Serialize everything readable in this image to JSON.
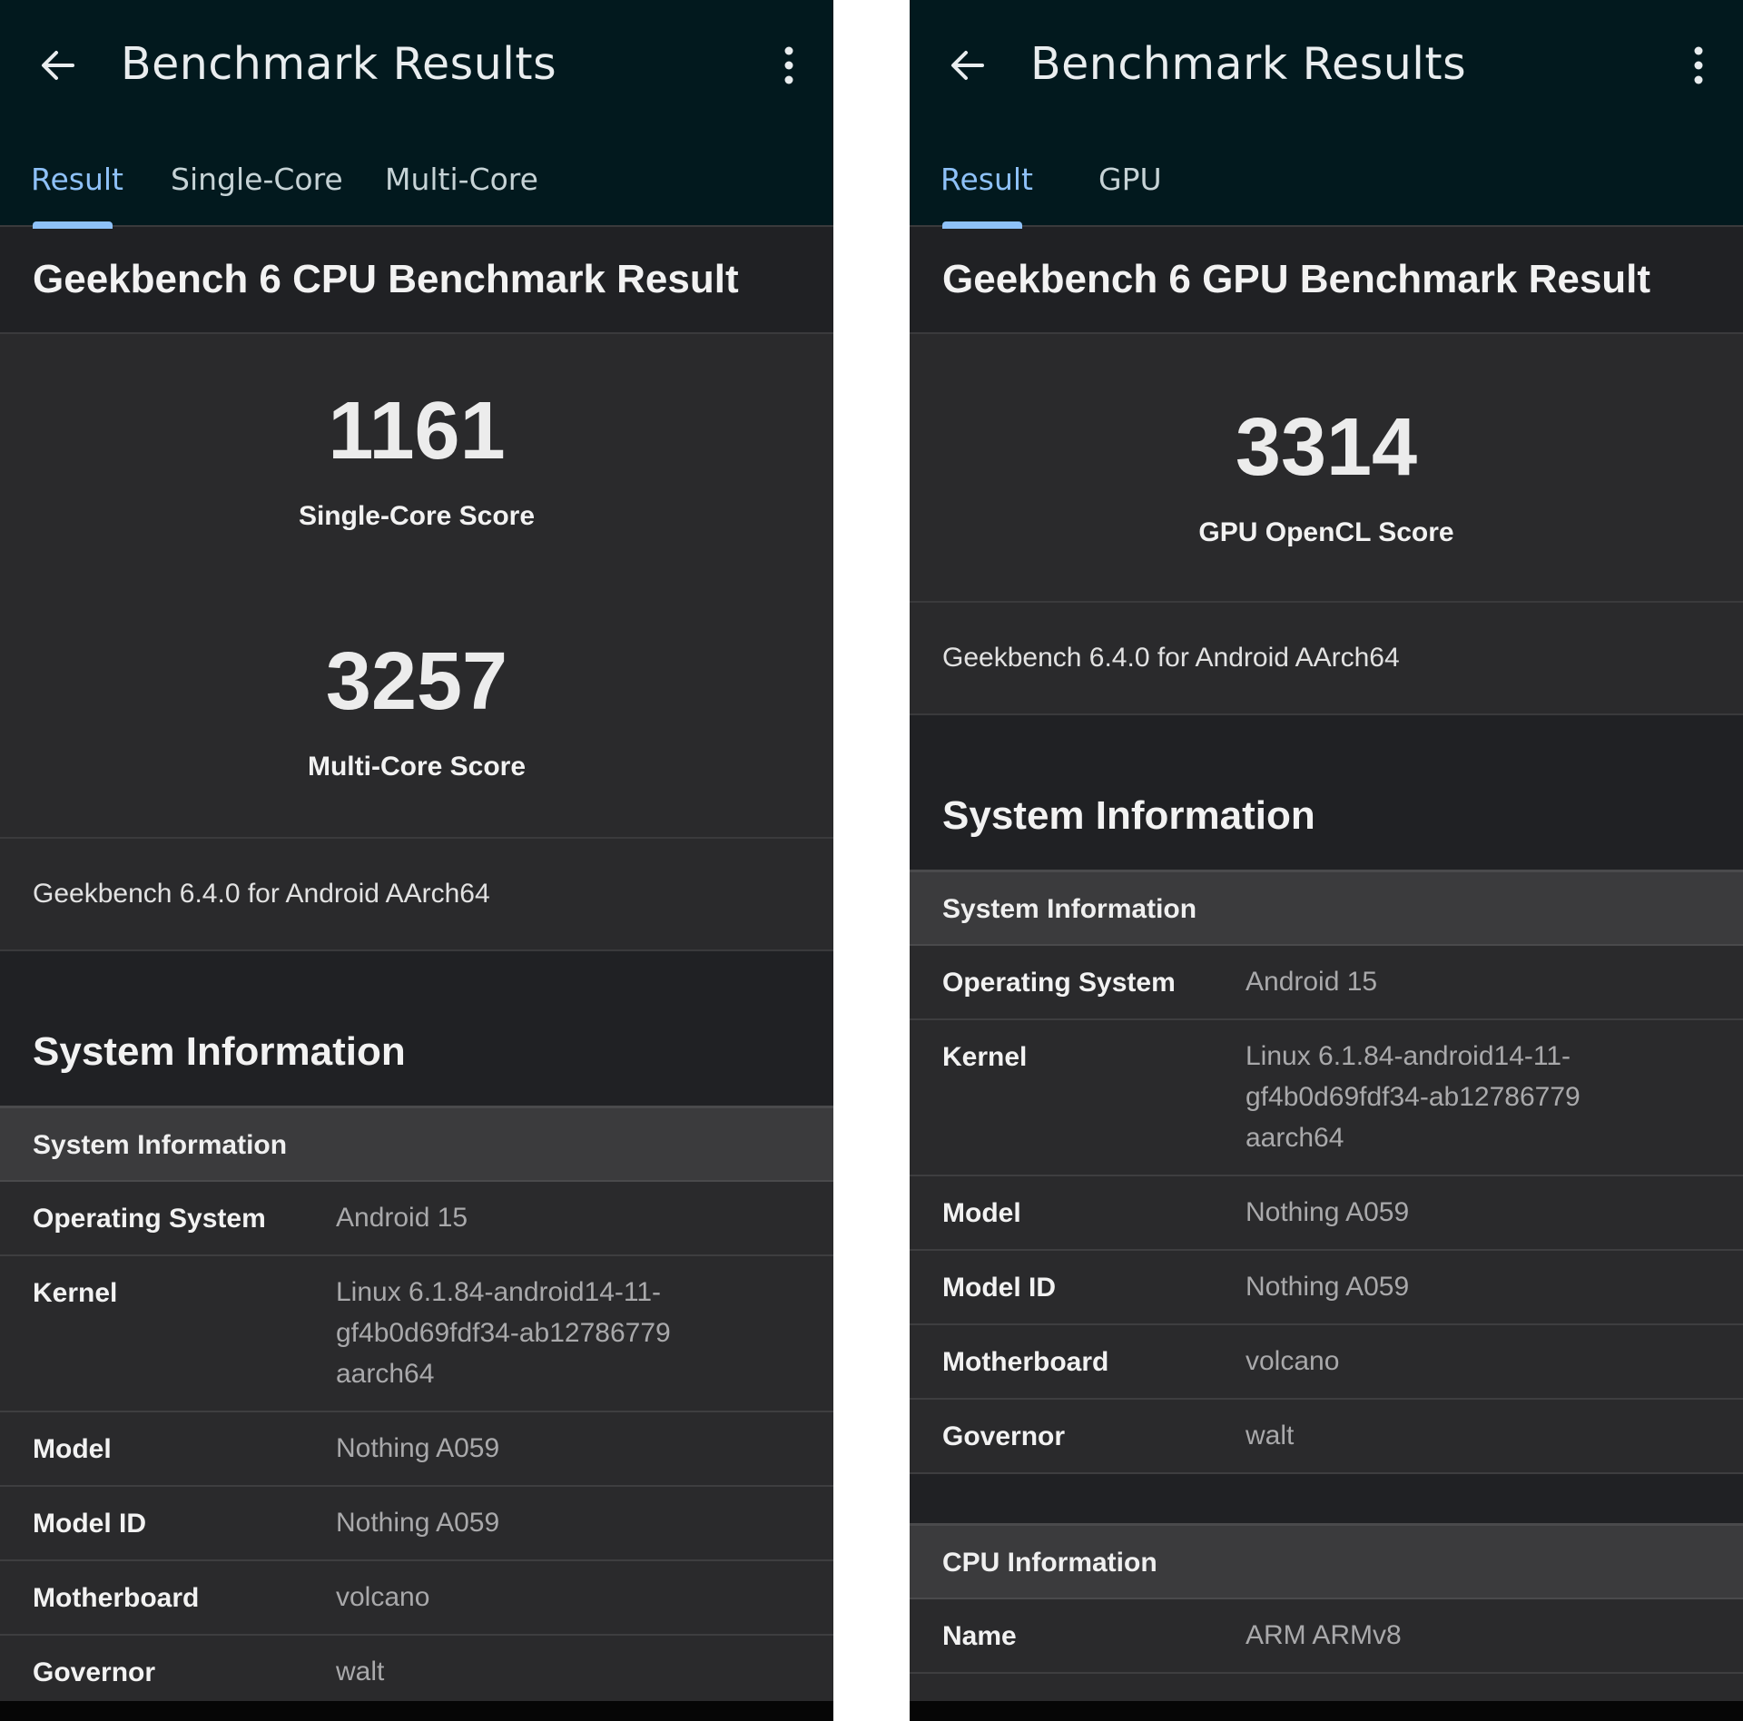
{
  "left": {
    "title": "Benchmark Results",
    "tabs": [
      "Result",
      "Single-Core",
      "Multi-Core"
    ],
    "result_heading": "Geekbench 6 CPU Benchmark Result",
    "scores": [
      {
        "value": "1161",
        "label": "Single-Core Score"
      },
      {
        "value": "3257",
        "label": "Multi-Core Score"
      }
    ],
    "version": "Geekbench 6.4.0 for Android AArch64",
    "system_heading": "System Information",
    "group": "System Information",
    "rows": [
      {
        "key": "Operating System",
        "value": "Android 15"
      },
      {
        "key": "Kernel",
        "value_lines": [
          "Linux 6.1.84-android14-11-",
          "gf4b0d69fdf34-ab12786779",
          "aarch64"
        ]
      },
      {
        "key": "Model",
        "value": "Nothing A059"
      },
      {
        "key": "Model ID",
        "value": "Nothing A059"
      },
      {
        "key": "Motherboard",
        "value": "volcano"
      },
      {
        "key": "Governor",
        "value": "walt"
      }
    ]
  },
  "right": {
    "title": "Benchmark Results",
    "tabs": [
      "Result",
      "GPU"
    ],
    "result_heading": "Geekbench 6 GPU Benchmark Result",
    "score": {
      "value": "3314",
      "label": "GPU OpenCL Score"
    },
    "version": "Geekbench 6.4.0 for Android AArch64",
    "system_heading": "System Information",
    "group": "System Information",
    "rows": [
      {
        "key": "Operating System",
        "value": "Android 15"
      },
      {
        "key": "Kernel",
        "value_lines": [
          "Linux 6.1.84-android14-11-",
          "gf4b0d69fdf34-ab12786779",
          "aarch64"
        ]
      },
      {
        "key": "Model",
        "value": "Nothing A059"
      },
      {
        "key": "Model ID",
        "value": "Nothing A059"
      },
      {
        "key": "Motherboard",
        "value": "volcano"
      },
      {
        "key": "Governor",
        "value": "walt"
      }
    ],
    "cpu_group": "CPU Information",
    "cpu_rows": [
      {
        "key": "Name",
        "value": "ARM ARMv8"
      }
    ]
  },
  "colors": {
    "appbar": "#02191e",
    "accent": "#8ec1f8",
    "surface": "#2a2a2c",
    "section": "#202124",
    "group": "#3b3b3d"
  }
}
